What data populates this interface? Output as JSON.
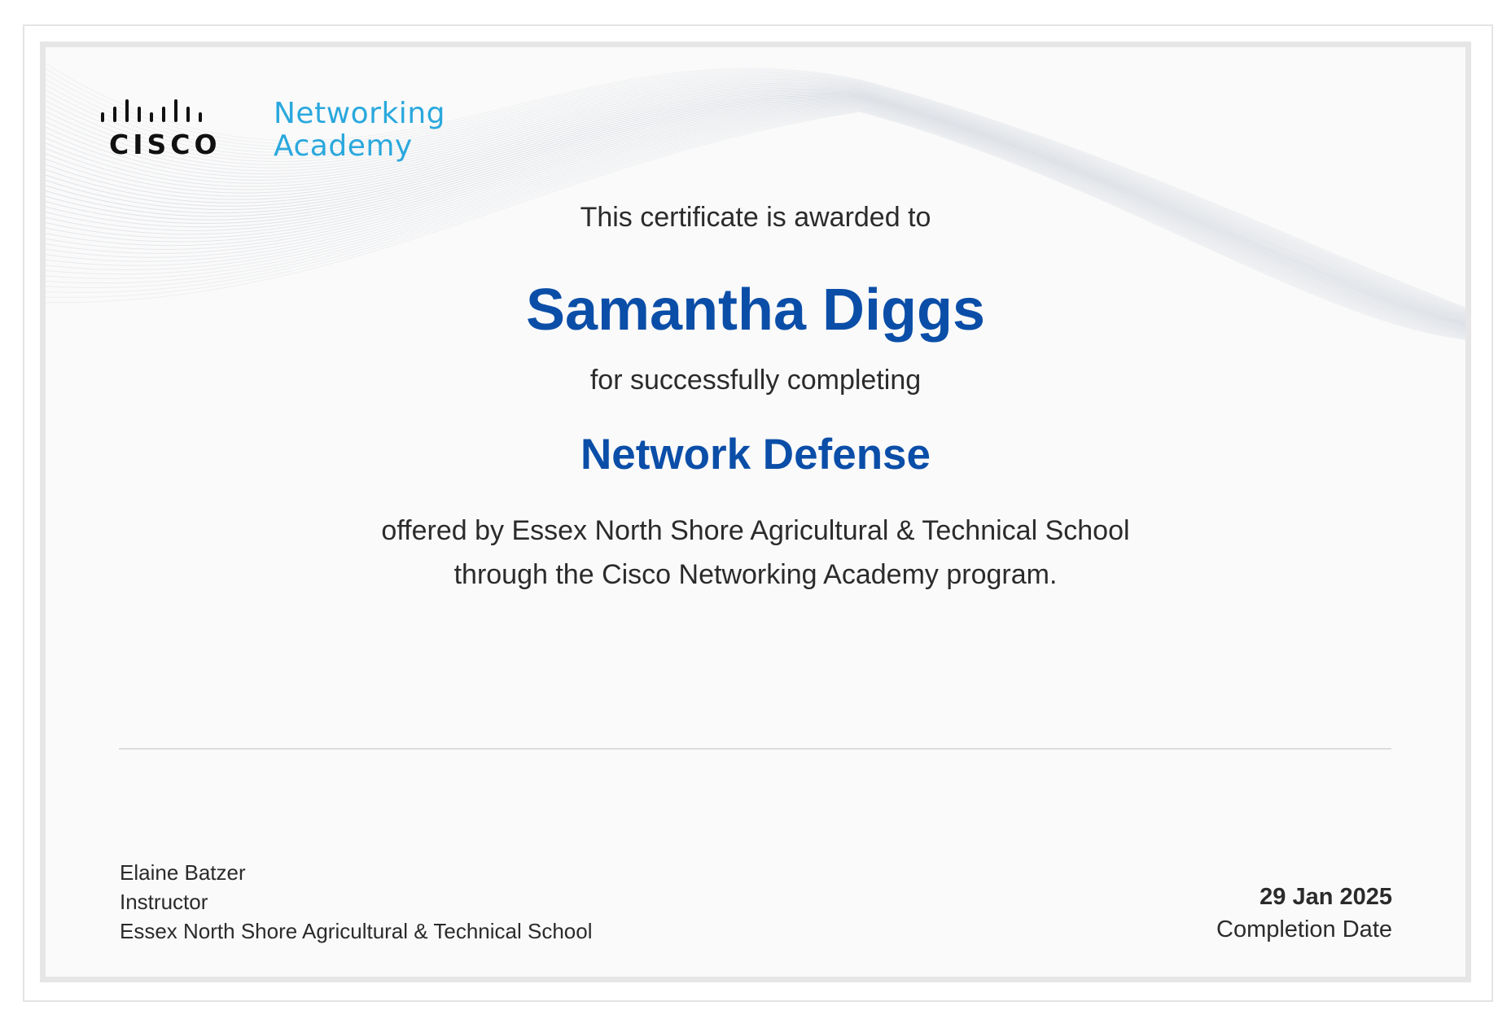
{
  "logo": {
    "brand": "CISCO",
    "line1": "Networking",
    "line2": "Academy"
  },
  "certificate": {
    "awarded_text": "This certificate is awarded to",
    "recipient": "Samantha Diggs",
    "completing_text": "for successfully completing",
    "course": "Network Defense",
    "offered_line1": "offered by Essex North Shore Agricultural & Technical School",
    "offered_line2": "through the Cisco Networking Academy program."
  },
  "signature": {
    "name": "Elaine Batzer",
    "title": "Instructor",
    "organization": "Essex North Shore Agricultural & Technical School"
  },
  "completion": {
    "date": "29 Jan 2025",
    "label": "Completion Date"
  },
  "colors": {
    "accent_blue": "#0b4ea8",
    "logo_cyan": "#2aa8dd"
  }
}
